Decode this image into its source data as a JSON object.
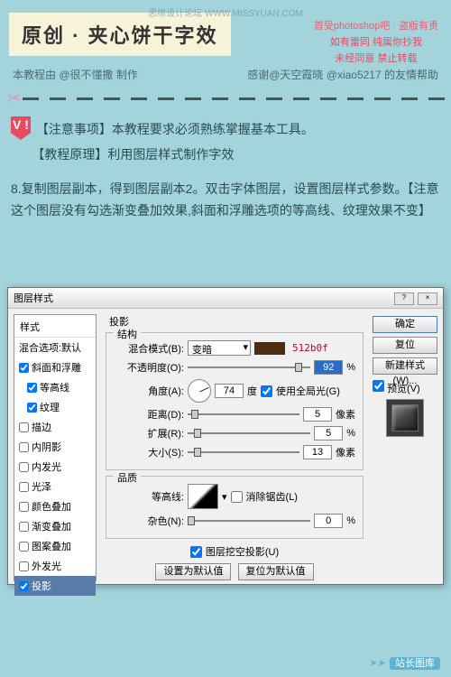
{
  "watermark": "思缘设计论坛 WWW.MISSYUAN.COM",
  "title": "原创 · 夹心饼干字效",
  "redNotes": {
    "line1": "首受photoshop吧 · 盗版有责",
    "line2": "如有雷同 纯属你抄我",
    "line3": "未经同意 禁止转载"
  },
  "authorLeft": "本教程由 @很不懂撒 制作",
  "authorRight": "感谢@天空霞晓 @xiao5217 的友情帮助",
  "vLabel": "V !",
  "notice1": "【注意事项】本教程要求必须熟练掌握基本工具。",
  "notice2": "【教程原理】利用图层样式制作字效",
  "step": "8.复制图层副本，得到图层副本2。双击字体图层，设置图层样式参数。【注意这个图层没有勾选渐变叠加效果,斜面和浮雕选项的等高线、纹理效果不变】",
  "dialog": {
    "title": "图层样式",
    "sideHeader": "样式",
    "sideDefault": "混合选项:默认",
    "items": [
      {
        "label": "斜面和浮雕",
        "checked": true,
        "sel": false
      },
      {
        "label": "等高线",
        "checked": true,
        "sel": false,
        "indent": true
      },
      {
        "label": "纹理",
        "checked": true,
        "sel": false,
        "indent": true
      },
      {
        "label": "描边",
        "checked": false,
        "sel": false
      },
      {
        "label": "内阴影",
        "checked": false,
        "sel": false
      },
      {
        "label": "内发光",
        "checked": false,
        "sel": false
      },
      {
        "label": "光泽",
        "checked": false,
        "sel": false
      },
      {
        "label": "颜色叠加",
        "checked": false,
        "sel": false
      },
      {
        "label": "渐变叠加",
        "checked": false,
        "sel": false
      },
      {
        "label": "图案叠加",
        "checked": false,
        "sel": false
      },
      {
        "label": "外发光",
        "checked": false,
        "sel": false
      },
      {
        "label": "投影",
        "checked": true,
        "sel": true
      }
    ],
    "panelTitle": "投影",
    "group1": "结构",
    "blendModeLabel": "混合模式(B):",
    "blendMode": "变暗",
    "colorHex": "512b0f",
    "opacityLabel": "不透明度(O):",
    "opacity": "92",
    "angleLabel": "角度(A):",
    "angle": "74",
    "angleUnit": "度",
    "globalLight": "使用全局光(G)",
    "distanceLabel": "距离(D):",
    "distance": "5",
    "spreadLabel": "扩展(R):",
    "spread": "5",
    "sizeLabel": "大小(S):",
    "size": "13",
    "pxUnit": "像素",
    "pctUnit": "%",
    "group2": "品质",
    "contourLabel": "等高线:",
    "antiAlias": "消除锯齿(L)",
    "noiseLabel": "杂色(N):",
    "noise": "0",
    "knockout": "图层挖空投影(U)",
    "btnDefault": "设置为默认值",
    "btnReset": "复位为默认值",
    "btnOk": "确定",
    "btnCancel": "复位",
    "btnNew": "新建样式(W)...",
    "preview": "预览(V)"
  },
  "footer": {
    "arrow": "➤➤",
    "text": "站长图库"
  }
}
